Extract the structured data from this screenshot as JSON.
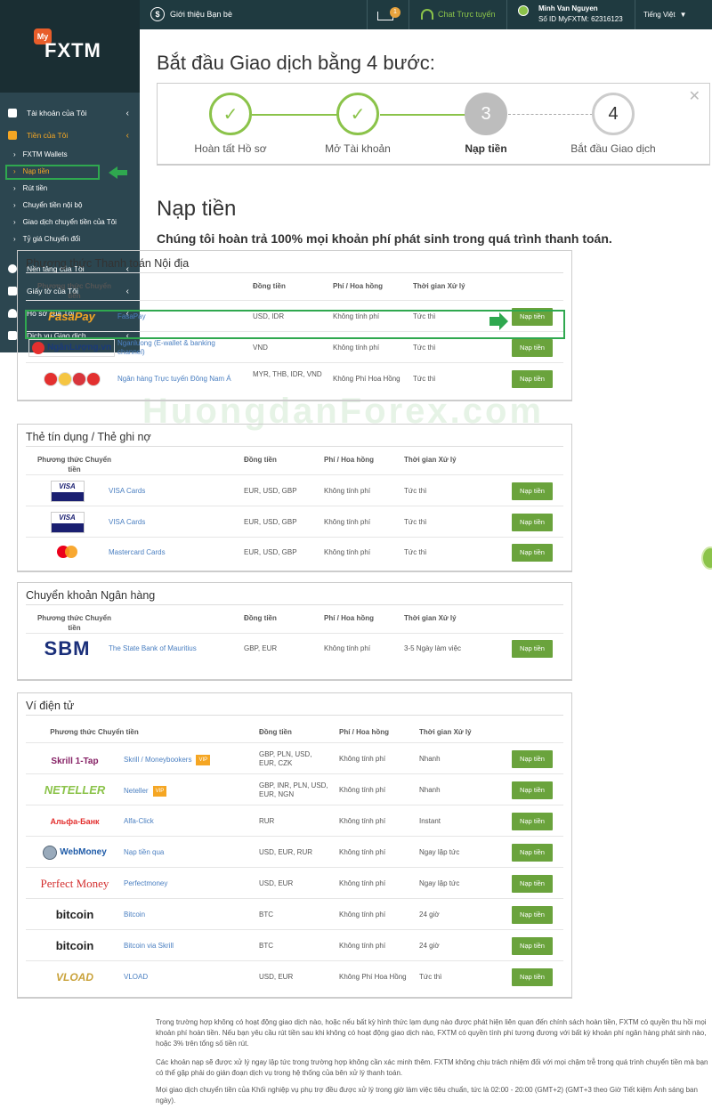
{
  "topbar": {
    "referral": "Giới thiệu Bạn bè",
    "inbox_badge": "1",
    "chat": "Chat Trực tuyến",
    "user_name": "Minh Van Nguyen",
    "user_id": "Số ID MyFXTM: 62316123",
    "language": "Tiếng Việt"
  },
  "sidebar": {
    "logo_my": "My",
    "logo_fxtm": "FXTM",
    "items": [
      {
        "label": "Tài khoản của Tôi"
      },
      {
        "label": "Tiền của Tôi"
      },
      {
        "label": "Nền tảng của Tôi"
      },
      {
        "label": "Giấy tờ của Tôi"
      },
      {
        "label": "Hồ sơ của Tôi"
      },
      {
        "label": "Dịch vụ Giao dịch"
      }
    ],
    "sub_items": [
      {
        "label": "FXTM Wallets"
      },
      {
        "label": "Nạp tiền"
      },
      {
        "label": "Rút tiền"
      },
      {
        "label": "Chuyển tiền nội bộ"
      },
      {
        "label": "Giao dịch chuyển tiền của Tôi"
      },
      {
        "label": "Tỷ giá Chuyển đổi"
      }
    ]
  },
  "steps": {
    "title": "Bắt đầu Giao dịch bằng 4 bước:",
    "items": [
      {
        "label": "Hoàn tất Hồ sơ",
        "mark": "✓"
      },
      {
        "label": "Mở Tài khoản",
        "mark": "✓"
      },
      {
        "label": "Nạp tiền",
        "mark": "3"
      },
      {
        "label": "Bắt đầu Giao dịch",
        "mark": "4"
      }
    ]
  },
  "deposit": {
    "title": "Nạp tiền",
    "refund_note": "Chúng tôi hoàn trả 100% mọi khoản phí phát sinh trong quá trình thanh toán.",
    "button_label": "Nạp tiền",
    "headers": {
      "method": "Phương thức Chuyển tiền",
      "currency": "Đồng tiền",
      "fee": "Phí / Hoa hồng",
      "time": "Thời gian Xử lý"
    }
  },
  "sections": [
    {
      "title": "Phương thức Thanh toán Nội địa",
      "rows": [
        {
          "logo": "FasaPay",
          "name": "FasaPay",
          "currency": "USD, IDR",
          "fee": "Không tính phí",
          "time": "Tức thì"
        },
        {
          "logo": "NgânLượng.vn",
          "name": "Nganluong (E-wallet & banking channel)",
          "currency": "VND",
          "fee": "Không tính phí",
          "time": "Tức thì"
        },
        {
          "logo": "",
          "name": "Ngân hàng Trực tuyến Đông Nam Á",
          "currency": "MYR, THB, IDR, VND",
          "fee": "Không Phí Hoa Hồng",
          "time": "Tức thì"
        }
      ]
    },
    {
      "title": "Thẻ tín dụng / Thẻ ghi nợ",
      "rows": [
        {
          "logo": "VISA",
          "name": "VISA Cards",
          "currency": "EUR, USD, GBP",
          "fee": "Không tính phí",
          "time": "Tức thì"
        },
        {
          "logo": "VISA",
          "name": "VISA Cards",
          "currency": "EUR, USD, GBP",
          "fee": "Không tính phí",
          "time": "Tức thì"
        },
        {
          "logo": "mastercard",
          "name": "Mastercard Cards",
          "currency": "EUR, USD, GBP",
          "fee": "Không tính phí",
          "time": "Tức thì"
        }
      ]
    },
    {
      "title": "Chuyển khoản Ngân hàng",
      "rows": [
        {
          "logo": "SBM",
          "name": "The State Bank of Mauritius",
          "currency": "GBP, EUR",
          "fee": "Không tính phí",
          "time": "3-5 Ngày làm việc"
        }
      ]
    },
    {
      "title": "Ví điện tử",
      "rows": [
        {
          "logo": "Skrill 1-Tap",
          "name": "Skrill / Moneybookers",
          "vip": "VIP",
          "currency": "GBP, PLN, USD, EUR, CZK",
          "fee": "Không tính phí",
          "time": "Nhanh"
        },
        {
          "logo": "NETELLER",
          "name": "Neteller",
          "vip": "VIP",
          "currency": "GBP, INR, PLN, USD, EUR, NGN",
          "fee": "Không tính phí",
          "time": "Nhanh"
        },
        {
          "logo": "Альфа-Банк",
          "name": "Alfa-Click",
          "currency": "RUR",
          "fee": "Không tính phí",
          "time": "Instant"
        },
        {
          "logo": "WebMoney",
          "name": "Nạp tiền qua",
          "currency": "USD, EUR, RUR",
          "fee": "Không tính phí",
          "time": "Ngay lập tức"
        },
        {
          "logo": "Perfect Money",
          "name": "Perfectmoney",
          "currency": "USD, EUR",
          "fee": "Không tính phí",
          "time": "Ngay lập tức"
        },
        {
          "logo": "bitcoin",
          "name": "Bitcoin",
          "currency": "BTC",
          "fee": "Không tính phí",
          "time": "24 giờ"
        },
        {
          "logo": "bitcoin",
          "name": "Bitcoin via Skrill",
          "currency": "BTC",
          "fee": "Không tính phí",
          "time": "24 giờ"
        },
        {
          "logo": "VLOAD",
          "name": "VLOAD",
          "currency": "USD, EUR",
          "fee": "Không Phí Hoa Hồng",
          "time": "Tức thì"
        }
      ]
    }
  ],
  "watermark": "HuongdanForex.com",
  "notes": [
    "Trong trường hợp không có hoạt động giao dịch nào, hoặc nếu bất kỳ hình thức lạm dụng nào được phát hiện liên quan đến chính sách hoàn tiền, FXTM có quyền thu hồi mọi khoản phí hoàn tiền. Nếu bạn yêu cầu rút tiền sau khi không có hoạt động giao dịch nào, FXTM có quyền tính phí tương đương với bất kỳ khoản phí ngân hàng phát sinh nào, hoặc 3% trên tổng số tiền rút.",
    "Các khoản nạp sẽ được xử lý ngay lập tức trong trường hợp không cần xác minh thêm. FXTM không chịu trách nhiệm đối với mọi chậm trễ trong quá trình chuyển tiền mà bạn có thể gặp phải do gián đoạn dịch vụ trong hệ thống của bên xử lý thanh toán.",
    "Mọi giao dịch chuyển tiền của Khối nghiệp vụ phụ trợ đều được xử lý trong giờ làm việc tiêu chuẩn, tức là 02:00 - 20:00 (GMT+2) (GMT+3 theo Giờ Tiết kiệm Ánh sáng ban ngày)."
  ]
}
